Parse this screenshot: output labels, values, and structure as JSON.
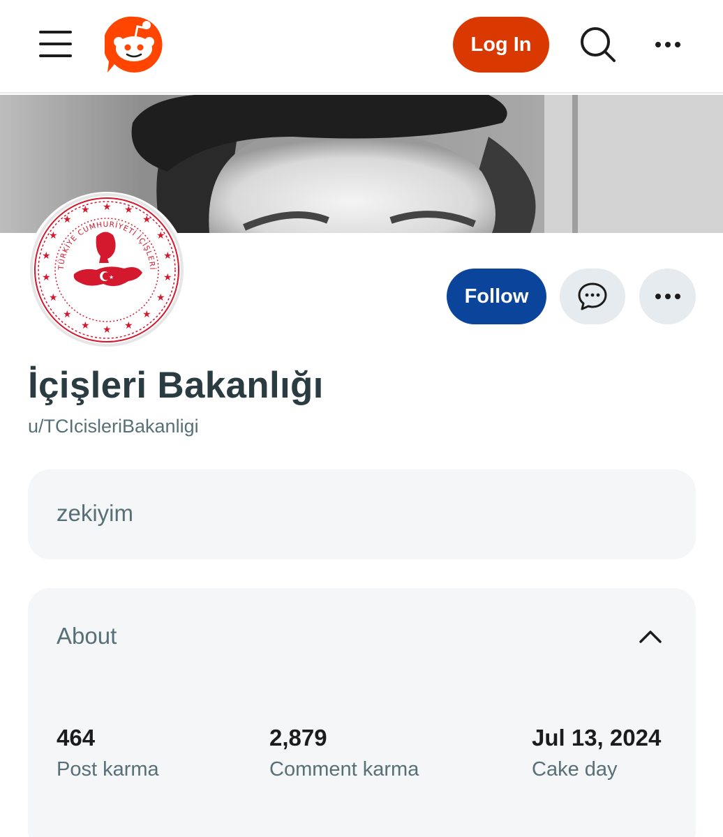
{
  "header": {
    "login_label": "Log In",
    "brand_color": "#d93900"
  },
  "profile": {
    "display_name": "İçişleri Bakanlığı",
    "username": "u/TCIcisleriBakanligi",
    "follow_label": "Follow",
    "follow_color": "#0a449b",
    "avatar_seal_text": "TÜRKİYE CUMHURİYETİ İÇİŞLERİ BAKANLIĞI",
    "seal_color": "#d4182e"
  },
  "bio": {
    "text": "zekiyim"
  },
  "about": {
    "title": "About",
    "stats": [
      {
        "value": "464",
        "label": "Post karma"
      },
      {
        "value": "2,879",
        "label": "Comment karma"
      },
      {
        "value": "Jul 13, 2024",
        "label": "Cake day"
      }
    ]
  },
  "icons": [
    "menu-icon",
    "reddit-logo-icon",
    "search-icon",
    "more-horizontal-icon",
    "chat-icon",
    "chevron-up-icon"
  ]
}
